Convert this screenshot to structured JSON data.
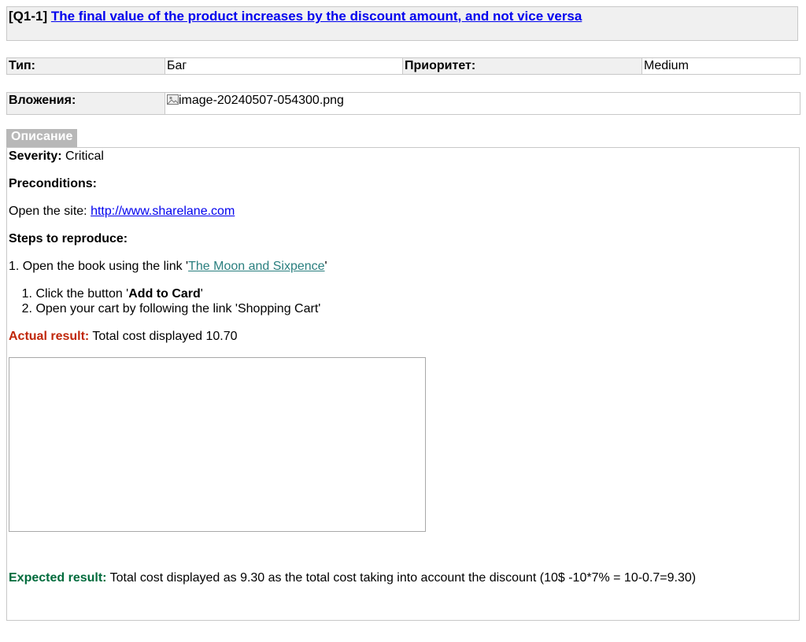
{
  "issue": {
    "key": "[Q1-1]",
    "summary": "The final value of the product increases by the discount amount, and not vice versa"
  },
  "fields": {
    "type_label": "Тип:",
    "type_value": "Баг",
    "priority_label": "Приоритет:",
    "priority_value": "Medium",
    "attachments_label": "Вложения:",
    "attachment_name": "image-20240507-054300.png"
  },
  "description": {
    "tab_label": "Описание",
    "severity_label": "Severity:",
    "severity_value": "Critical",
    "preconditions_label": "Preconditions:",
    "open_site_text": "Open the site:",
    "site_link": "http://www.sharelane.com",
    "steps_label": "Steps to reproduce:",
    "step1_prefix": "1. Open the book using the link '",
    "step1_link": "The Moon and Sixpence",
    "step1_suffix": "'",
    "steps": [
      {
        "num": "1.",
        "prefix": "Click the button '",
        "bold": "Add to Card",
        "suffix": "'"
      },
      {
        "num": "2.",
        "text": "Open your cart by following the link 'Shopping Cart'"
      }
    ],
    "actual_label": "Actual result:",
    "actual_value": "Total cost displayed 10.70",
    "expected_label": "Expected result:",
    "expected_value": "Total cost displayed as 9.30 as the total cost taking into account the discount (10$ -10*7% = 10-0.7=9.30)"
  },
  "colors": {
    "link": "#0000ee",
    "teal_link": "#2a7f7f",
    "actual_label": "#c0270b",
    "expected_label": "#006b3c",
    "label_bg": "#f0f0f0",
    "tab_bg": "#b8b8b8"
  },
  "icons": {
    "attachment": "image-file-icon"
  }
}
